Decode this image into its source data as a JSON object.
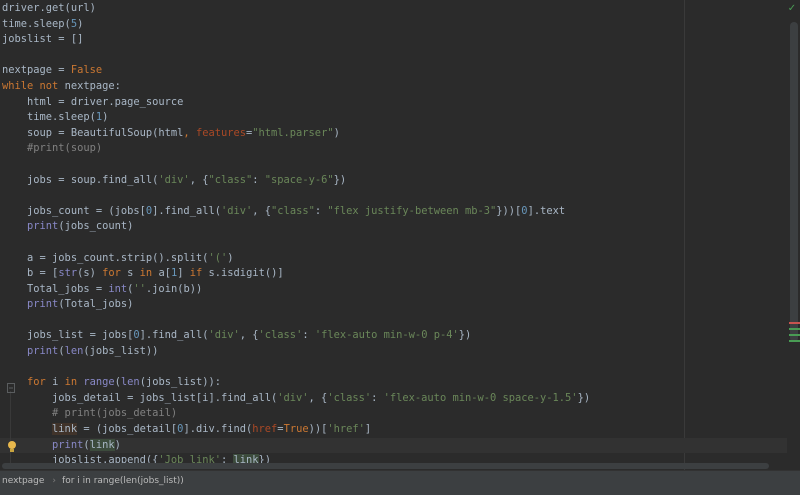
{
  "editor": {
    "lines": [
      {
        "indent": 0,
        "tokens": [
          [
            "driver.get(url)",
            "name"
          ]
        ]
      },
      {
        "indent": 0,
        "tokens": [
          [
            "time.sleep(",
            "name"
          ],
          [
            "5",
            "num"
          ],
          [
            ")",
            "name"
          ]
        ]
      },
      {
        "indent": 0,
        "tokens": [
          [
            "jobslist = []",
            "name"
          ]
        ]
      },
      {
        "indent": 0,
        "tokens": []
      },
      {
        "indent": 0,
        "tokens": [
          [
            "nextpage = ",
            "name"
          ],
          [
            "False",
            "kw"
          ]
        ]
      },
      {
        "indent": 0,
        "tokens": [
          [
            "while not ",
            "kw"
          ],
          [
            "nextpage:",
            "name"
          ]
        ]
      },
      {
        "indent": 1,
        "tokens": [
          [
            "    html = driver.page_source",
            "name"
          ]
        ]
      },
      {
        "indent": 1,
        "tokens": [
          [
            "    time.sleep(",
            "name"
          ],
          [
            "1",
            "num"
          ],
          [
            ")",
            "name"
          ]
        ]
      },
      {
        "indent": 1,
        "tokens": [
          [
            "    soup = BeautifulSoup(html",
            "name"
          ],
          [
            ", ",
            "kw"
          ],
          [
            "features",
            "param"
          ],
          [
            "=",
            "name"
          ],
          [
            "\"html.parser\"",
            "str"
          ],
          [
            ")",
            "name"
          ]
        ]
      },
      {
        "indent": 1,
        "tokens": [
          [
            "    #print(soup)",
            "comment"
          ]
        ]
      },
      {
        "indent": 1,
        "tokens": []
      },
      {
        "indent": 1,
        "tokens": [
          [
            "    jobs = soup.find_all(",
            "name"
          ],
          [
            "'div'",
            "str"
          ],
          [
            ", {",
            "name"
          ],
          [
            "\"class\"",
            "str"
          ],
          [
            ": ",
            "name"
          ],
          [
            "\"space-y-6\"",
            "str"
          ],
          [
            "})",
            "name"
          ]
        ]
      },
      {
        "indent": 1,
        "tokens": []
      },
      {
        "indent": 1,
        "tokens": [
          [
            "    jobs_count = (jobs[",
            "name"
          ],
          [
            "0",
            "num"
          ],
          [
            "].find_all(",
            "name"
          ],
          [
            "'div'",
            "str"
          ],
          [
            ", {",
            "name"
          ],
          [
            "\"class\"",
            "str"
          ],
          [
            ": ",
            "name"
          ],
          [
            "\"flex justify-between mb-3\"",
            "str"
          ],
          [
            "}))[",
            "name"
          ],
          [
            "0",
            "num"
          ],
          [
            "].text",
            "name"
          ]
        ]
      },
      {
        "indent": 1,
        "tokens": [
          [
            "    ",
            "name"
          ],
          [
            "print",
            "builtin"
          ],
          [
            "(jobs_count)",
            "name"
          ]
        ]
      },
      {
        "indent": 1,
        "tokens": []
      },
      {
        "indent": 1,
        "tokens": [
          [
            "    a = jobs_count.strip().split(",
            "name"
          ],
          [
            "'('",
            "str"
          ],
          [
            ")",
            "name"
          ]
        ]
      },
      {
        "indent": 1,
        "tokens": [
          [
            "    b = [",
            "name"
          ],
          [
            "str",
            "builtin"
          ],
          [
            "(s) ",
            "name"
          ],
          [
            "for ",
            "kw"
          ],
          [
            "s ",
            "name"
          ],
          [
            "in ",
            "kw"
          ],
          [
            "a[",
            "name"
          ],
          [
            "1",
            "num"
          ],
          [
            "] ",
            "name"
          ],
          [
            "if ",
            "kw"
          ],
          [
            "s.isdigit()]",
            "name"
          ]
        ]
      },
      {
        "indent": 1,
        "tokens": [
          [
            "    Total_jobs = ",
            "name"
          ],
          [
            "int",
            "builtin"
          ],
          [
            "(",
            "name"
          ],
          [
            "''",
            "str"
          ],
          [
            ".join(b))",
            "name"
          ]
        ]
      },
      {
        "indent": 1,
        "tokens": [
          [
            "    ",
            "name"
          ],
          [
            "print",
            "builtin"
          ],
          [
            "(Total_jobs)",
            "name"
          ]
        ]
      },
      {
        "indent": 1,
        "tokens": []
      },
      {
        "indent": 1,
        "tokens": [
          [
            "    jobs_list = jobs[",
            "name"
          ],
          [
            "0",
            "num"
          ],
          [
            "].find_all(",
            "name"
          ],
          [
            "'div'",
            "str"
          ],
          [
            ", {",
            "name"
          ],
          [
            "'class'",
            "str"
          ],
          [
            ": ",
            "name"
          ],
          [
            "'flex-auto min-w-0 p-4'",
            "str"
          ],
          [
            "})",
            "name"
          ]
        ]
      },
      {
        "indent": 1,
        "tokens": [
          [
            "    ",
            "name"
          ],
          [
            "print",
            "builtin"
          ],
          [
            "(",
            "name"
          ],
          [
            "len",
            "builtin"
          ],
          [
            "(jobs_list))",
            "name"
          ]
        ]
      },
      {
        "indent": 1,
        "tokens": []
      },
      {
        "indent": 1,
        "tokens": [
          [
            "    ",
            "name"
          ],
          [
            "for ",
            "kw"
          ],
          [
            "i ",
            "name"
          ],
          [
            "in ",
            "kw"
          ],
          [
            "range",
            "builtin"
          ],
          [
            "(",
            "name"
          ],
          [
            "len",
            "builtin"
          ],
          [
            "(jobs_list)):",
            "name"
          ]
        ]
      },
      {
        "indent": 2,
        "tokens": [
          [
            "        jobs_detail = jobs_list[i].find_all(",
            "name"
          ],
          [
            "'div'",
            "str"
          ],
          [
            ", {",
            "name"
          ],
          [
            "'class'",
            "str"
          ],
          [
            ": ",
            "name"
          ],
          [
            "'flex-auto min-w-0 space-y-1.5'",
            "str"
          ],
          [
            "})",
            "name"
          ]
        ]
      },
      {
        "indent": 2,
        "tokens": [
          [
            "        # print(jobs_detail)",
            "comment"
          ]
        ]
      },
      {
        "indent": 2,
        "tokens": [
          [
            "        ",
            "name"
          ],
          [
            "link",
            "hl-ident"
          ],
          [
            " = (jobs_detail[",
            "name"
          ],
          [
            "0",
            "num"
          ],
          [
            "].div.find(",
            "name"
          ],
          [
            "href",
            "param"
          ],
          [
            "=",
            "name"
          ],
          [
            "True",
            "kw"
          ],
          [
            "))[",
            "name"
          ],
          [
            "'href'",
            "str"
          ],
          [
            "]",
            "name"
          ]
        ]
      },
      {
        "indent": 2,
        "current": true,
        "tokens": [
          [
            "        ",
            "name"
          ],
          [
            "print",
            "builtin"
          ],
          [
            "(",
            "name"
          ],
          [
            "link",
            "hl-ref"
          ],
          [
            ")",
            "name"
          ]
        ]
      },
      {
        "indent": 2,
        "tokens": [
          [
            "        jobslist.append({",
            "name"
          ],
          [
            "'Job_link'",
            "str"
          ],
          [
            ": ",
            "name"
          ],
          [
            "link",
            "hl-ref"
          ],
          [
            "})",
            "name"
          ]
        ]
      }
    ]
  },
  "gutter": {
    "bulb_line": 28,
    "fold_line": 24
  },
  "breadcrumbs": [
    "nextpage",
    "for i in range(len(jobs_list))"
  ],
  "icons": {
    "inspection": "checkmark-icon",
    "bulb": "lightbulb-icon",
    "fold": "fold-icon",
    "separator": "chevron-right-icon"
  },
  "colors": {
    "background": "#2b2b2b",
    "keyword": "#cc7832",
    "string": "#6a8759",
    "number": "#6897bb",
    "comment": "#808080",
    "param": "#aa4926",
    "builtin": "#8888c6",
    "text": "#a9b7c6"
  }
}
